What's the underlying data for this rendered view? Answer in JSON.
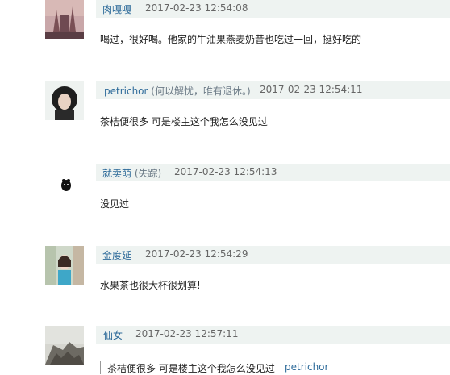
{
  "comments": [
    {
      "username": "肉嘎嘎",
      "tag": "",
      "time": "2017-02-23 12:54:08",
      "text": "喝过，很好喝。他家的牛油果燕麦奶昔也吃过一回，挺好吃的",
      "avatar": "avatar-castle"
    },
    {
      "username": "petrichor",
      "tag": "(何以解忧，唯有退休。)",
      "time": "2017-02-23 12:54:11",
      "text": "茶桔便很多 可是楼主这个我怎么没见过",
      "avatar": "avatar-girl-dark"
    },
    {
      "username": "就卖萌",
      "tag": "(失踪)",
      "time": "2017-02-23 12:54:13",
      "text": "没见过",
      "avatar": "avatar-small-animal"
    },
    {
      "username": "金度延",
      "tag": "",
      "time": "2017-02-23 12:54:29",
      "text": "水果茶也很大杯很划算!",
      "avatar": "avatar-girl-street"
    },
    {
      "username": "仙女",
      "tag": "",
      "time": "2017-02-23 12:57:11",
      "text": "",
      "quote": {
        "text": "茶桔便很多 可是楼主这个我怎么没见过",
        "user": "petrichor"
      },
      "avatar": "avatar-rocks"
    }
  ]
}
